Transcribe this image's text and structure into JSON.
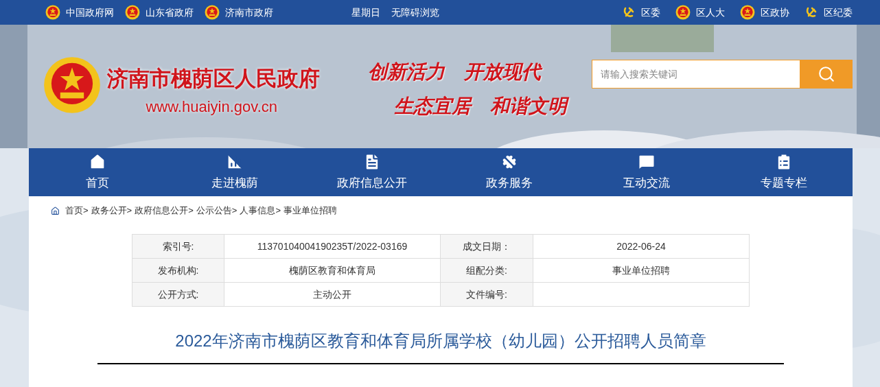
{
  "top_bar": {
    "left_links": [
      {
        "label": "中国政府网"
      },
      {
        "label": "山东省政府"
      },
      {
        "label": "济南市政府"
      }
    ],
    "center_links": [
      {
        "label": "星期日"
      },
      {
        "label": "无障碍浏览"
      }
    ],
    "right_links": [
      {
        "label": "区委",
        "kind": "party"
      },
      {
        "label": "区人大",
        "kind": "emblem"
      },
      {
        "label": "区政协",
        "kind": "cppcc"
      },
      {
        "label": "区纪委",
        "kind": "party"
      }
    ]
  },
  "header": {
    "site_name": "济南市槐荫区人民政府",
    "url": "www.huaiyin.gov.cn",
    "slogans": [
      "创新活力　开放现代",
      "生态宜居　和谐文明"
    ],
    "search": {
      "placeholder": "请输入搜索关键词"
    }
  },
  "nav": [
    {
      "label": "首页"
    },
    {
      "label": "走进槐荫"
    },
    {
      "label": "政府信息公开"
    },
    {
      "label": "政务服务"
    },
    {
      "label": "互动交流"
    },
    {
      "label": "专题专栏"
    }
  ],
  "breadcrumb": [
    "首页>",
    "政务公开>",
    "政府信息公开>",
    "公示公告>",
    "人事信息>",
    "事业单位招聘"
  ],
  "meta_table": [
    {
      "label_1": "索引号:",
      "value_1": "11370104004190235T/2022-03169",
      "label_2": "成文日期：",
      "value_2": "2022-06-24"
    },
    {
      "label_1": "发布机构:",
      "value_1": "槐荫区教育和体育局",
      "label_2": "组配分类:",
      "value_2": "事业单位招聘"
    },
    {
      "label_1": "公开方式:",
      "value_1": "主动公开",
      "label_2": "文件编号:"
    }
  ],
  "article": {
    "title": "2022年济南市槐荫区教育和体育局所属学校（幼儿园）公开招聘人员简章"
  }
}
